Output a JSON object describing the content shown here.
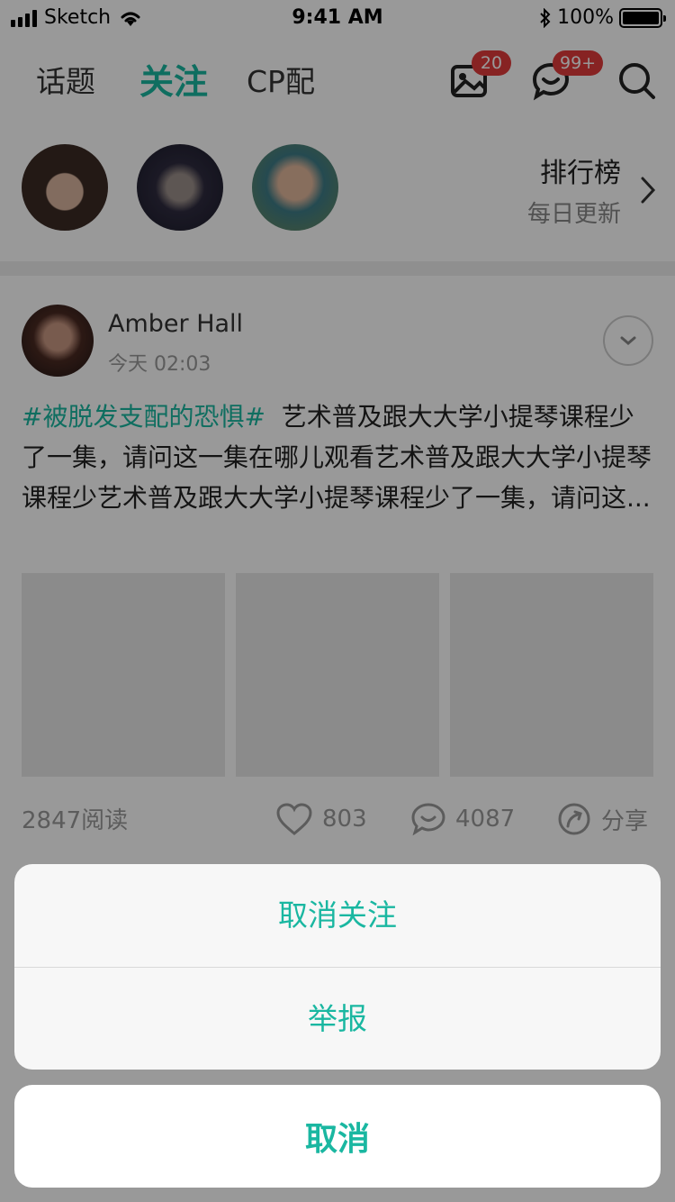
{
  "status_bar": {
    "carrier": "Sketch",
    "time": "9:41 AM",
    "battery_percent": "100%",
    "icons": [
      "signal-icon",
      "wifi-icon",
      "bluetooth-icon",
      "battery-icon"
    ]
  },
  "nav": {
    "tabs": [
      {
        "label": "话题",
        "active": false
      },
      {
        "label": "关注",
        "active": true
      },
      {
        "label": "CP配",
        "active": false
      }
    ],
    "photo_badge": "20",
    "message_badge": "99+",
    "icons": [
      "photo-icon",
      "message-icon",
      "search-icon"
    ]
  },
  "featured": {
    "ranking_title": "排行榜",
    "ranking_subtitle": "每日更新"
  },
  "post": {
    "author": "Amber Hall",
    "time": "今天 02:03",
    "topic": "#被脱发支配的恐惧#",
    "body": "艺术普及跟大大学小提琴课程少了一集，请问这一集在哪儿观看艺术普及跟大大学小提琴课程少艺术普及跟大大学小提琴课程少了一集，请问这...",
    "reads": "2847阅读",
    "likes": "803",
    "comments": "4087",
    "share": "分享"
  },
  "action_sheet": {
    "unfollow": "取消关注",
    "report": "举报",
    "cancel": "取消"
  },
  "colors": {
    "accent": "#1ab7a1",
    "badge": "#e23b3b"
  }
}
